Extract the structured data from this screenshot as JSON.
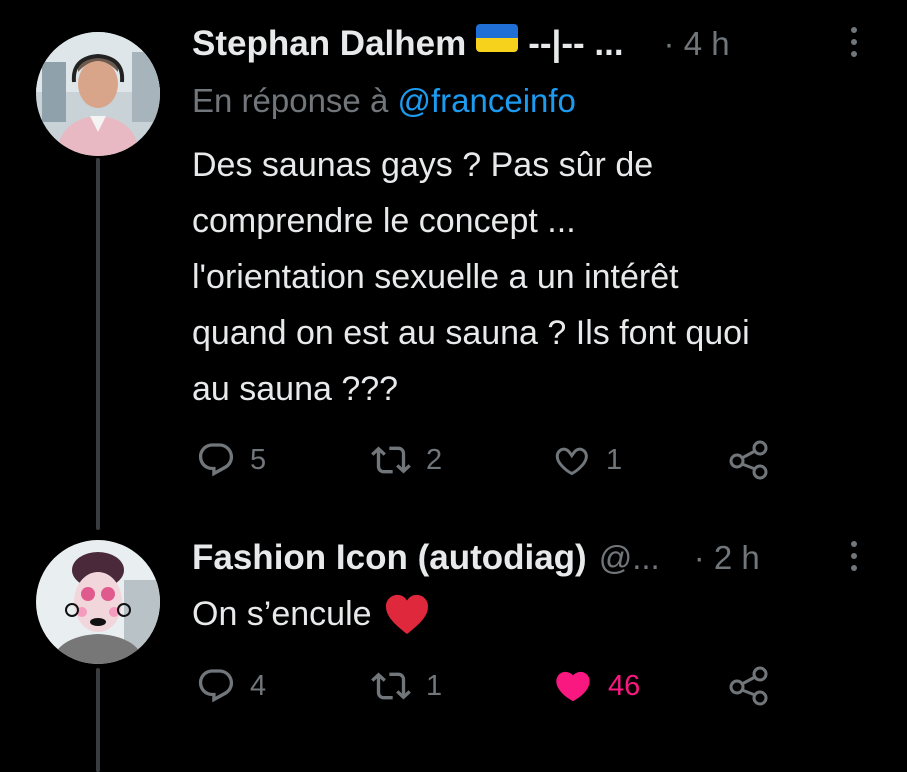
{
  "tweets": [
    {
      "name": "Stephan Dalhem",
      "name_suffix": "--|-- ...",
      "time": "· 4 h",
      "reply_label": "En réponse à",
      "reply_handle": "@franceinfo",
      "text_lines": [
        "Des saunas gays ? Pas sûr de",
        "comprendre le concept ...",
        "l'orientation sexuelle a un intérêt",
        "quand on est au sauna ? Ils font quoi",
        "au sauna ???"
      ],
      "replies": "5",
      "retweets": "2",
      "likes": "1",
      "liked": false
    },
    {
      "name": "Fashion Icon (autodiag)",
      "handle": "@...",
      "time": "· 2 h",
      "text": "On s’encule",
      "replies": "4",
      "retweets": "1",
      "likes": "46",
      "liked": true
    }
  ],
  "icons": {
    "flag": "ukraine-flag-icon",
    "reply": "reply-icon",
    "retweet": "retweet-icon",
    "like": "heart-icon",
    "share": "share-icon",
    "more": "more-vertical-icon",
    "emoji_heart": "red-heart-emoji"
  },
  "colors": {
    "background": "#000000",
    "text": "#e7e9ea",
    "muted": "#71767b",
    "link": "#1d9bf0",
    "like": "#f91880"
  }
}
